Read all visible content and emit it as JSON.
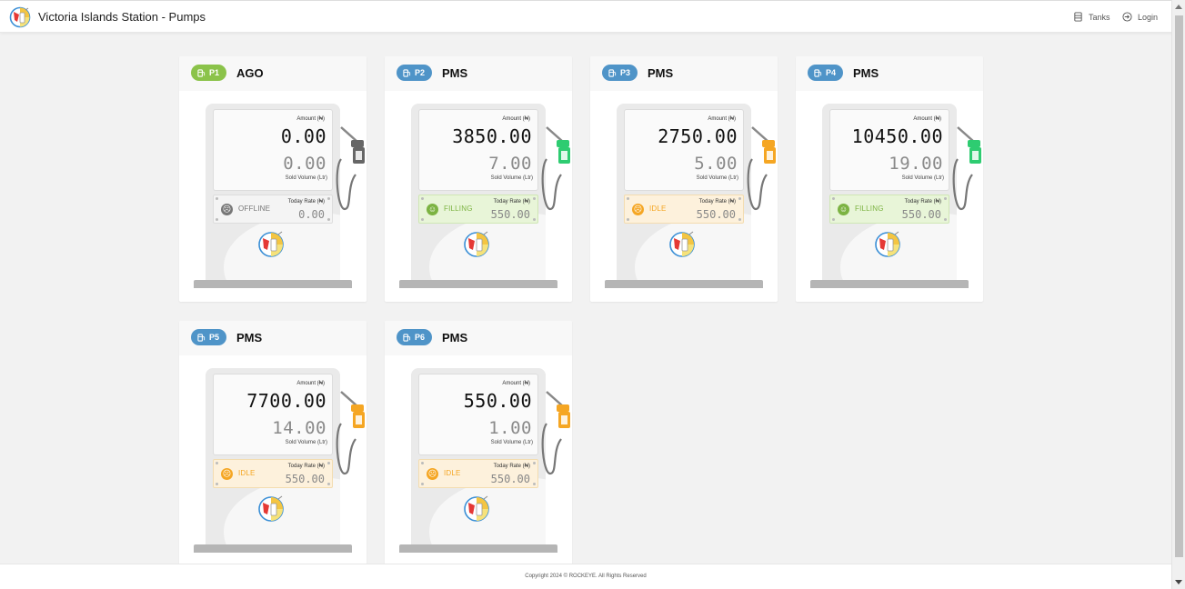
{
  "header": {
    "title": "Victoria Islands Station - Pumps",
    "nav": [
      {
        "label": "Tanks",
        "icon": "tank-icon"
      },
      {
        "label": "Login",
        "icon": "login-icon"
      }
    ]
  },
  "colors": {
    "green": "#8bc34a",
    "blue": "#4f94c8",
    "offline_gray": "#777777",
    "filling_text": "#7cb342",
    "filling_bg": "#e8f5d8",
    "idle_text": "#f5a623",
    "idle_bg": "#fdf1dc",
    "nozzle_gray": "#666666",
    "nozzle_green": "#2ecc71",
    "nozzle_orange": "#f5a623"
  },
  "labels": {
    "amount": "Amount (₦)",
    "sold_volume": "Sold Volume (Ltr)",
    "today_rate": "Today Rate (₦)"
  },
  "pumps": [
    {
      "id": "P1",
      "fuel": "AGO",
      "amount": "0.00",
      "volume": "0.00",
      "rate": "0.00",
      "status": "OFFLINE",
      "badge_color": "#8bc34a",
      "nozzle_color": "#666666"
    },
    {
      "id": "P2",
      "fuel": "PMS",
      "amount": "3850.00",
      "volume": "7.00",
      "rate": "550.00",
      "status": "FILLING",
      "badge_color": "#4f94c8",
      "nozzle_color": "#2ecc71"
    },
    {
      "id": "P3",
      "fuel": "PMS",
      "amount": "2750.00",
      "volume": "5.00",
      "rate": "550.00",
      "status": "IDLE",
      "badge_color": "#4f94c8",
      "nozzle_color": "#f5a623"
    },
    {
      "id": "P4",
      "fuel": "PMS",
      "amount": "10450.00",
      "volume": "19.00",
      "rate": "550.00",
      "status": "FILLING",
      "badge_color": "#4f94c8",
      "nozzle_color": "#2ecc71"
    },
    {
      "id": "P5",
      "fuel": "PMS",
      "amount": "7700.00",
      "volume": "14.00",
      "rate": "550.00",
      "status": "IDLE",
      "badge_color": "#4f94c8",
      "nozzle_color": "#f5a623"
    },
    {
      "id": "P6",
      "fuel": "PMS",
      "amount": "550.00",
      "volume": "1.00",
      "rate": "550.00",
      "status": "IDLE",
      "badge_color": "#4f94c8",
      "nozzle_color": "#f5a623"
    }
  ],
  "footer": {
    "text": "Copyright 2024 © ROCKEYE. All Rights Reserved"
  }
}
